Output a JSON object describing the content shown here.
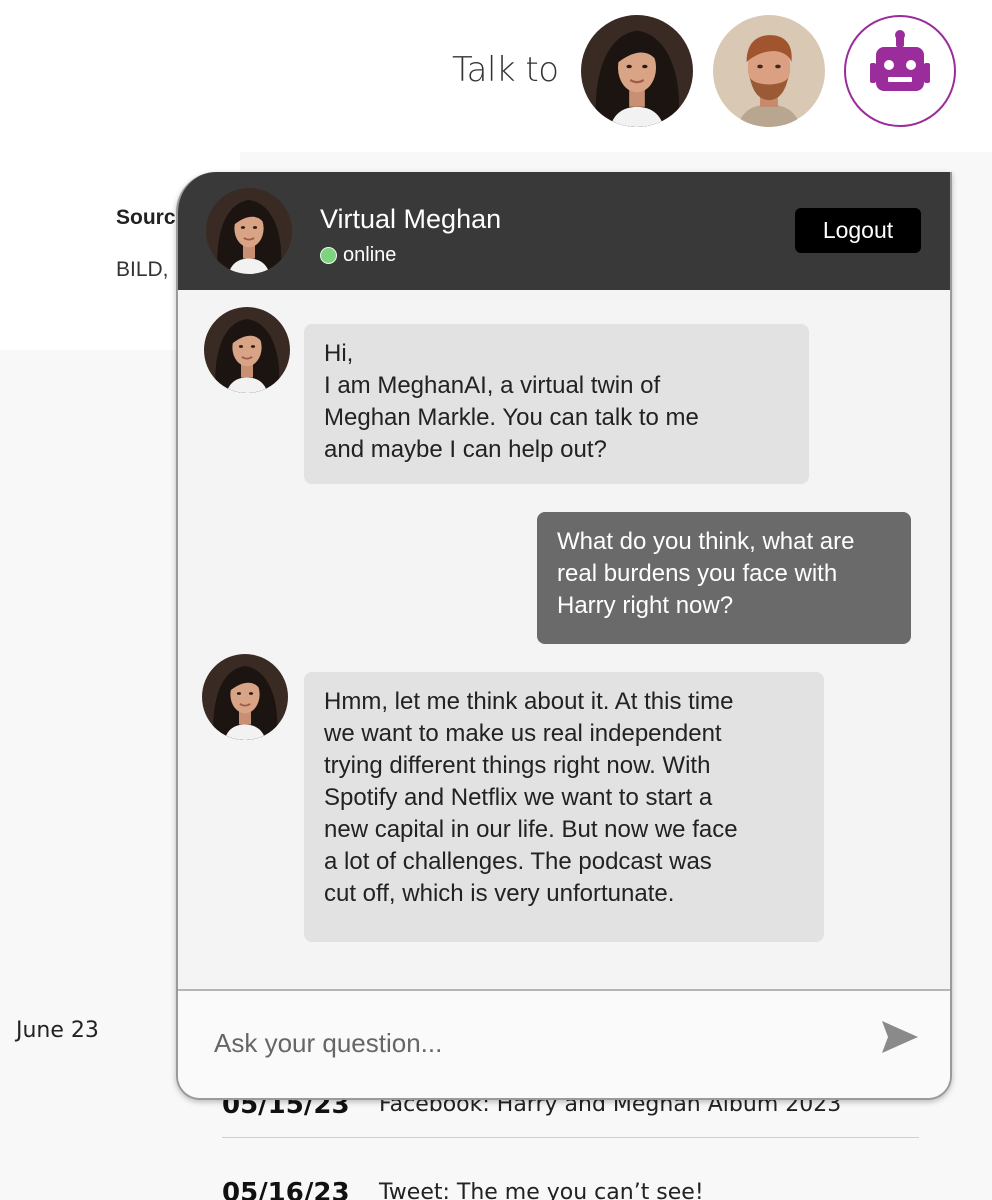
{
  "topbar": {
    "talk_label": "Talk to"
  },
  "background": {
    "source_title": "Sourc",
    "source_text": "BILD,",
    "june_label": "June 23",
    "timeline": [
      {
        "date": "05/15/23",
        "text": "Facebook: Harry and Meghan Album 2023"
      },
      {
        "date": "05/16/23",
        "text": "Tweet: The me you can’t see!"
      }
    ]
  },
  "chat": {
    "name": "Virtual Meghan",
    "status": "online",
    "logout_label": "Logout",
    "messages": [
      {
        "from": "bot",
        "lines": [
          "Hi,",
          "I am MeghanAI, a virtual twin of",
          "Meghan Markle. You can talk to me",
          "and maybe I can help out?"
        ]
      },
      {
        "from": "user",
        "lines": [
          "What do you think, what are",
          "real burdens you face with",
          "Harry right now?"
        ]
      },
      {
        "from": "bot",
        "lines": [
          "Hmm, let me think about it. At this time",
          "we want to make us real independent",
          "trying different things right now. With",
          "Spotify and Netflix we want to start a",
          "new capital in our life. But now we face",
          "a lot of challenges. The podcast was",
          "cut off, which is very unfortunate."
        ]
      }
    ],
    "input_placeholder": "Ask your question..."
  },
  "colors": {
    "header": "#393939",
    "bot_bubble": "#e2e2e2",
    "user_bubble": "#6b6a6a",
    "online": "#7ed37e",
    "bot_accent": "#9b2c9b"
  },
  "icons": {
    "send": "send-arrow-icon",
    "bot": "robot-icon"
  }
}
